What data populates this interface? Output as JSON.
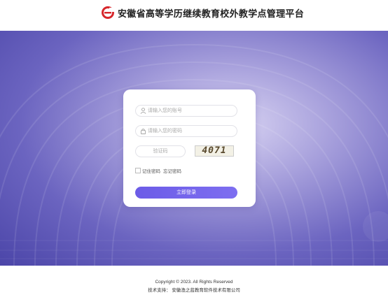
{
  "header": {
    "title": "安徽省高等学历继续教育校外教学点管理平台",
    "logo_icon": "e-logo-icon",
    "brand_color": "#d7262b"
  },
  "login": {
    "account_placeholder": "请输入您的账号",
    "password_placeholder": "请输入您的密码",
    "captcha_placeholder": "验证码",
    "captcha_code": "4071",
    "remember_label": "记住密码",
    "forgot_label": "忘记密码",
    "login_button": "立即登录",
    "accent_color": "#6c5ce7"
  },
  "footer": {
    "copyright": "Copyright © 2023. All Rights Reserved",
    "support": "技术支持：  安徽渔之蓝教育软件技术有限公司"
  }
}
